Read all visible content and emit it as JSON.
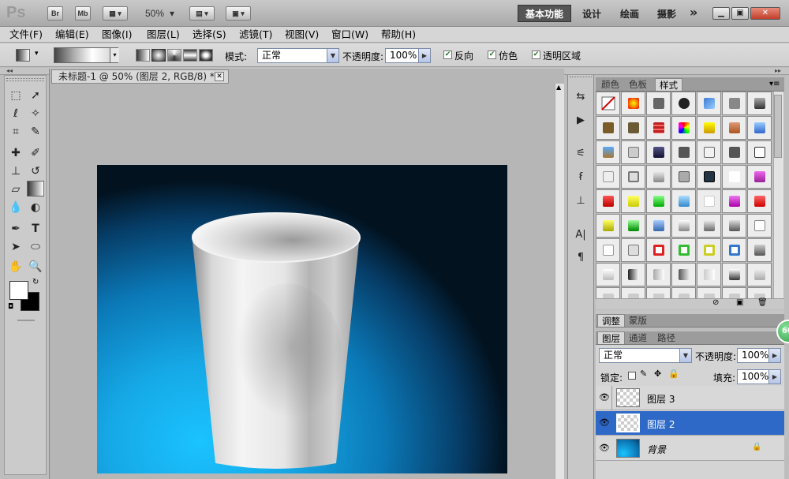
{
  "app": {
    "logo": "Ps",
    "bridge_btn": "Br",
    "minibridge_btn": "Mb",
    "zoom": "50%",
    "workspaces": [
      "基本功能",
      "设计",
      "绘画",
      "摄影"
    ],
    "more_workspaces": "»",
    "window_buttons": [
      "▁",
      "▣",
      "✕"
    ]
  },
  "menu": [
    "文件(F)",
    "编辑(E)",
    "图像(I)",
    "图层(L)",
    "选择(S)",
    "滤镜(T)",
    "视图(V)",
    "窗口(W)",
    "帮助(H)"
  ],
  "options": {
    "mode_label": "模式:",
    "mode_value": "正常",
    "opacity_label": "不透明度:",
    "opacity_value": "100%",
    "reverse_label": "反向",
    "dither_label": "仿色",
    "transparency_label": "透明区域"
  },
  "document": {
    "tab_title": "未标题-1 @ 50% (图层 2, RGB/8) *",
    "close": "✕"
  },
  "panels": {
    "top_tabs": [
      "颜色",
      "色板",
      "样式"
    ],
    "adjust_tabs": [
      "调整",
      "蒙版"
    ],
    "layer_tabs": [
      "图层",
      "通道",
      "路径"
    ],
    "blend_mode": "正常",
    "opacity_label": "不透明度:",
    "opacity_value": "100%",
    "lock_label": "锁定:",
    "fill_label": "填充:",
    "fill_value": "100%"
  },
  "layers": [
    {
      "name": "图层 3",
      "selected": false
    },
    {
      "name": "图层 2",
      "selected": true
    },
    {
      "name": "背景",
      "selected": false
    }
  ],
  "badge": "60"
}
